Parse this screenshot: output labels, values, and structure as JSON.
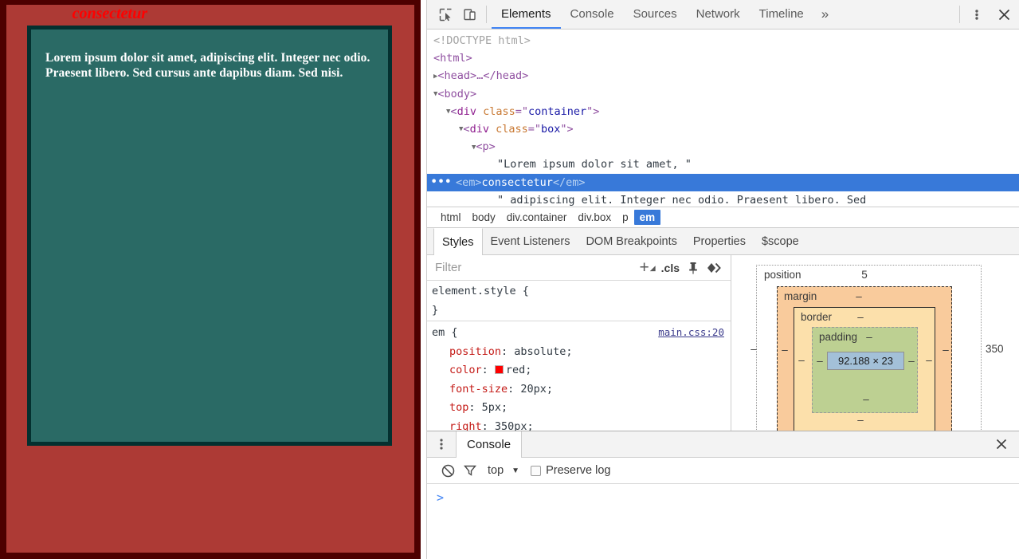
{
  "webpage": {
    "em_text": "consectetur",
    "paragraph": "Lorem ipsum dolor sit amet, adipiscing elit. Integer nec odio. Praesent libero. Sed cursus ante dapibus diam. Sed nisi.",
    "colors": {
      "container_bg": "#ad3a35",
      "container_border": "#4d0000",
      "box_bg": "#2a6a65",
      "box_border": "#04302f",
      "em_color": "#ff0000",
      "text_color": "#ffffff"
    }
  },
  "devtools": {
    "toolbar": {
      "inspect_icon": "inspect-element-icon",
      "device_icon": "device-toolbar-icon",
      "tabs": [
        {
          "label": "Elements",
          "active": true
        },
        {
          "label": "Console",
          "active": false
        },
        {
          "label": "Sources",
          "active": false
        },
        {
          "label": "Network",
          "active": false
        },
        {
          "label": "Timeline",
          "active": false
        }
      ],
      "more_label": "»",
      "kebab_icon": "more-options-icon",
      "close_icon": "close-icon",
      "accent": "#4285f4"
    },
    "dom_tree": {
      "lines": [
        {
          "indent": 0,
          "type": "doctype",
          "text": "<!DOCTYPE html>"
        },
        {
          "indent": 0,
          "type": "tag",
          "text": "<html>"
        },
        {
          "indent": 0,
          "type": "collapsed",
          "text": "<head>…</head>"
        },
        {
          "indent": 0,
          "type": "open",
          "text": "<body>"
        },
        {
          "indent": 1,
          "type": "open_attr",
          "tag": "div",
          "attr": "class",
          "value": "container"
        },
        {
          "indent": 2,
          "type": "open_attr",
          "tag": "div",
          "attr": "class",
          "value": "box"
        },
        {
          "indent": 3,
          "type": "open",
          "text": "<p>"
        },
        {
          "indent": 4,
          "type": "text",
          "text": "\"Lorem ipsum dolor sit amet, \""
        },
        {
          "indent": 4,
          "type": "selected",
          "text": "<em>consectetur</em>",
          "dots": "•••"
        },
        {
          "indent": 4,
          "type": "text_clipped",
          "text": "\" adipiscing elit. Integer nec odio. Praesent libero. Sed"
        }
      ]
    },
    "breadcrumb": {
      "items": [
        {
          "label": "html",
          "selected": false
        },
        {
          "label": "body",
          "selected": false
        },
        {
          "label": "div.container",
          "selected": false
        },
        {
          "label": "div.box",
          "selected": false
        },
        {
          "label": "p",
          "selected": false
        },
        {
          "label": "em",
          "selected": true
        }
      ]
    },
    "styles_tabs": [
      {
        "label": "Styles",
        "active": true
      },
      {
        "label": "Event Listeners",
        "active": false
      },
      {
        "label": "DOM Breakpoints",
        "active": false
      },
      {
        "label": "Properties",
        "active": false
      },
      {
        "label": "$scope",
        "active": false
      }
    ],
    "filter_bar": {
      "placeholder": "Filter",
      "value": "",
      "new_rule_icon": "plus-new-style-rule-icon",
      "cls_label": ".cls",
      "pin_icon": "pin-icon",
      "state_icon": "toggle-element-state-icon"
    },
    "rules": [
      {
        "selector": "element.style {",
        "source": "",
        "properties": [],
        "close": "}"
      },
      {
        "selector": "em {",
        "source": "main.css:20",
        "properties": [
          {
            "name": "position",
            "value": "absolute;",
            "swatch": null
          },
          {
            "name": "color",
            "value": "red;",
            "swatch": "#ff0000"
          },
          {
            "name": "font-size",
            "value": "20px;",
            "swatch": null
          },
          {
            "name": "top",
            "value": "5px;",
            "swatch": null
          },
          {
            "name": "right",
            "value": "350px;",
            "swatch": null
          }
        ],
        "close": ""
      }
    ],
    "box_model": {
      "position": {
        "label": "position",
        "top": "5",
        "right": "350",
        "bottom": "",
        "left": "–"
      },
      "margin": {
        "label": "margin",
        "top": "–",
        "right": "–",
        "bottom": "",
        "left": "–"
      },
      "border": {
        "label": "border",
        "top": "–",
        "right": "–",
        "bottom": "–",
        "left": "–"
      },
      "padding": {
        "label": "padding",
        "top": "–",
        "right": "–",
        "bottom": "–",
        "left": "–"
      },
      "content": "92.188 × 23",
      "colors": {
        "margin": "#f9cb9c",
        "border": "#fce0ab",
        "padding": "#bdd092",
        "content": "#a3c0d8"
      }
    },
    "drawer": {
      "kebab_icon": "drawer-more-options-icon",
      "tab_label": "Console",
      "close_icon": "drawer-close-icon",
      "clear_icon": "clear-console-icon",
      "filter_icon": "filter-icon",
      "context": "top",
      "context_arrow": "chevron-down-icon",
      "preserve_log_label": "Preserve log",
      "preserve_log_checked": false,
      "prompt": ">"
    }
  }
}
